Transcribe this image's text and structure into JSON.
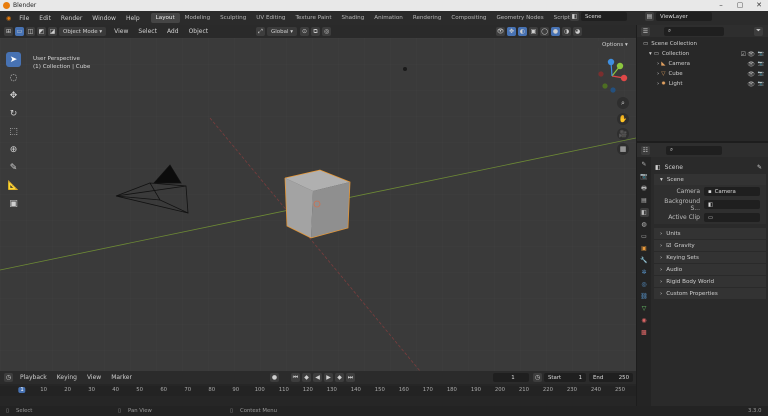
{
  "window": {
    "title": "Blender"
  },
  "menubar": {
    "items": [
      "File",
      "Edit",
      "Render",
      "Window",
      "Help"
    ],
    "workspaces": [
      "Layout",
      "Modeling",
      "Sculpting",
      "UV Editing",
      "Texture Paint",
      "Shading",
      "Animation",
      "Rendering",
      "Compositing",
      "Geometry Nodes",
      "Scripting"
    ],
    "active_workspace": "Layout",
    "add_tab": "+",
    "scene": "Scene",
    "view_layer": "ViewLayer"
  },
  "viewport_header": {
    "mode": "Object Mode",
    "menus": [
      "View",
      "Select",
      "Add",
      "Object"
    ],
    "transform_orientation": "Global",
    "options": "Options"
  },
  "viewport": {
    "info_line1": "User Perspective",
    "info_line2": "(1) Collection | Cube",
    "gizmo_x": "X",
    "gizmo_y": "Y",
    "gizmo_z": "Z"
  },
  "outliner": {
    "root": "Scene Collection",
    "collection": "Collection",
    "items": [
      {
        "name": "Camera",
        "icon_color": "#e0a060"
      },
      {
        "name": "Cube",
        "icon_color": "#e0a060"
      },
      {
        "name": "Light",
        "icon_color": "#e0a060"
      }
    ]
  },
  "properties": {
    "breadcrumb": "Scene",
    "scene_panel": "Scene",
    "camera_label": "Camera",
    "camera_value": "Camera",
    "background_label": "Background S...",
    "active_clip_label": "Active Clip",
    "units_panel": "Units",
    "gravity_label": "Gravity",
    "keying_sets_panel": "Keying Sets",
    "audio_panel": "Audio",
    "rigid_body_panel": "Rigid Body World",
    "custom_props_panel": "Custom Properties"
  },
  "timeline": {
    "menus": [
      "Playback",
      "Keying",
      "View",
      "Marker"
    ],
    "current_frame": "1",
    "start_label": "Start",
    "start_value": "1",
    "end_label": "End",
    "end_value": "250",
    "ruler_ticks": [
      "1",
      "10",
      "20",
      "30",
      "40",
      "50",
      "60",
      "70",
      "80",
      "90",
      "100",
      "110",
      "120",
      "130",
      "140",
      "150",
      "160",
      "170",
      "180",
      "190",
      "200",
      "210",
      "220",
      "230",
      "240",
      "250"
    ]
  },
  "statusbar": {
    "select": "Select",
    "pan_view": "Pan View",
    "context_menu": "Context Menu",
    "version": "3.3.0"
  },
  "colors": {
    "accent": "#4772b3",
    "x_axis": "#e04848",
    "y_axis": "#8cc63f",
    "z_axis": "#3f8fe0",
    "cube": "#9a9a9a"
  }
}
